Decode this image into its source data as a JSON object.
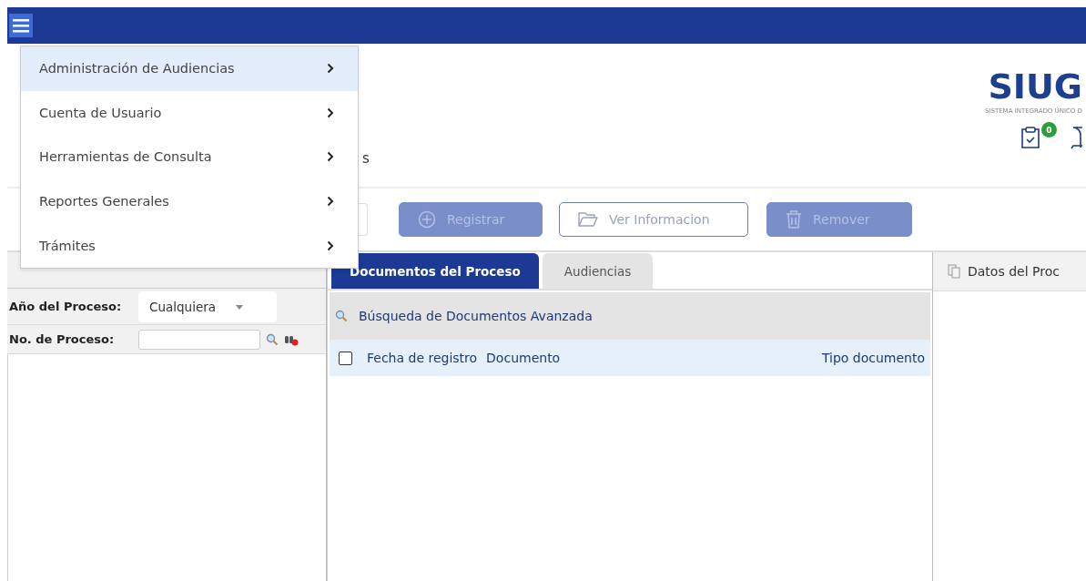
{
  "menu": {
    "items": [
      {
        "label": "Administración de Audiencias",
        "selected": true
      },
      {
        "label": "Cuenta de Usuario",
        "selected": false
      },
      {
        "label": "Herramientas de Consulta",
        "selected": false
      },
      {
        "label": "Reportes Generales",
        "selected": false
      },
      {
        "label": "Trámites",
        "selected": false
      }
    ]
  },
  "header": {
    "title": "s",
    "logo": "SIUG",
    "logo_subtitle": "SISTEMA INTEGRADO ÚNICO D",
    "tasks_badge": "0"
  },
  "toolbar": {
    "buttons": [
      {
        "label": "Registrar",
        "kind": "add",
        "disabled": true
      },
      {
        "label": "Ver Informacion",
        "kind": "folder",
        "disabled": false
      },
      {
        "label": "Remover",
        "kind": "trash",
        "disabled": true
      }
    ]
  },
  "filters": {
    "year_label": "Año del Proceso:",
    "year_value": "Cualquiera",
    "number_label": "No. de Proceso:"
  },
  "tabs": [
    {
      "label": "Documentos del Proceso",
      "selected": true
    },
    {
      "label": "Audiencias",
      "selected": false
    }
  ],
  "advanced_search": "Búsqueda de Documentos Avanzada",
  "table": {
    "checked": false,
    "columns": [
      "Fecha de registro",
      "Documento",
      "Tipo documento"
    ]
  },
  "details_panel": {
    "title": "Datos del Proc"
  }
}
